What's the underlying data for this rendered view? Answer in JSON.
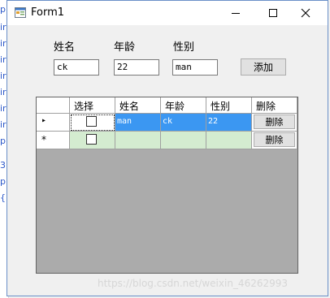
{
  "window": {
    "title": "Form1"
  },
  "form": {
    "name_label": "姓名",
    "age_label": "年龄",
    "gender_label": "性别",
    "name_value": "ck",
    "age_value": "22",
    "gender_value": "man",
    "add_button": "添加"
  },
  "grid": {
    "headers": [
      "选择",
      "姓名",
      "年龄",
      "性别",
      "删除"
    ],
    "rows": [
      {
        "checked": false,
        "name": "man",
        "age": "ck",
        "gender": "22",
        "delete_label": "删除",
        "selected": true,
        "indicator": "▸"
      },
      {
        "checked": false,
        "name": "",
        "age": "",
        "gender": "",
        "delete_label": "删除",
        "selected": false,
        "indicator": "*"
      }
    ]
  },
  "watermark": "https://blog.csdn.net/weixin_46262993",
  "colors": {
    "selection": "#3b97f2",
    "new_row": "#d4ecd0",
    "grid_background": "#ababab"
  },
  "background_editor_glyphs": [
    "p",
    "ir",
    "ir",
    "ir",
    "ir",
    "ir",
    "ir",
    "ir",
    "p",
    "3",
    "p",
    "{"
  ]
}
